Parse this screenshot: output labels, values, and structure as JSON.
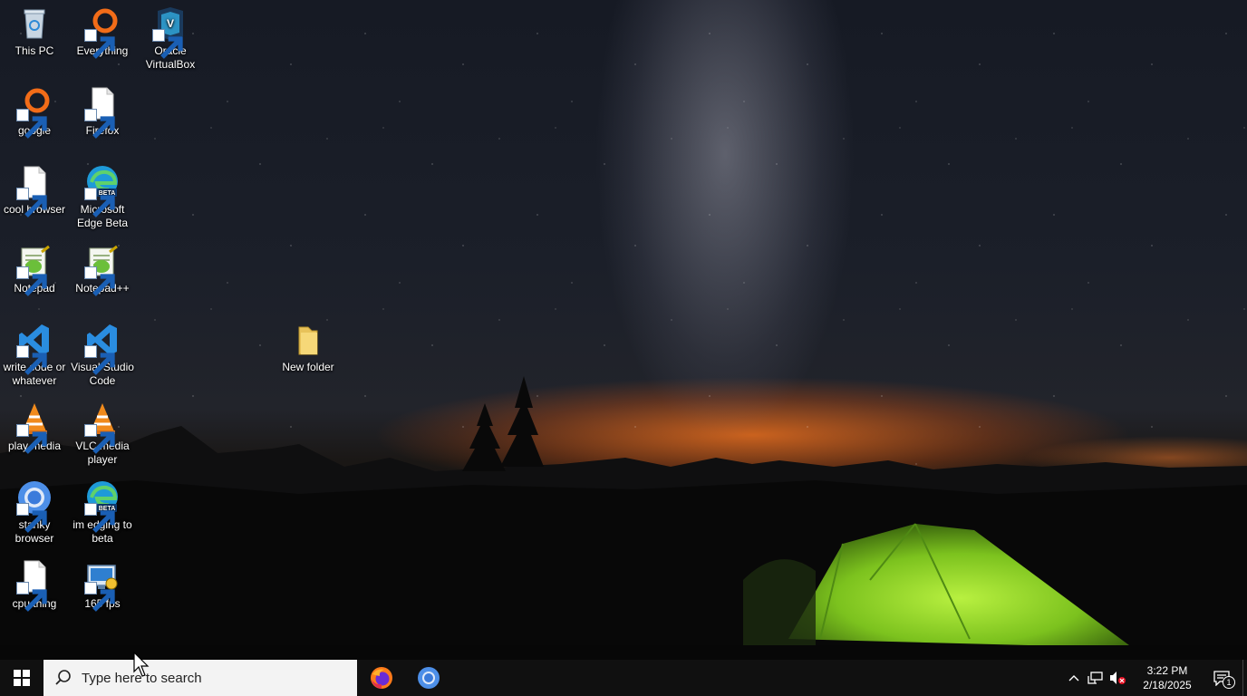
{
  "desktop": {
    "icons": [
      {
        "label": "This PC",
        "icon": "this-pc-icon"
      },
      {
        "label": "Everything",
        "icon": "everything-icon"
      },
      {
        "label": "Oracle VirtualBox",
        "icon": "virtualbox-icon"
      },
      {
        "label": "google",
        "icon": "everything-icon"
      },
      {
        "label": "Firefox",
        "icon": "blank-file-icon"
      },
      {
        "label": "cool browser",
        "icon": "blank-file-icon"
      },
      {
        "label": "Microsoft Edge Beta",
        "icon": "edge-beta-icon"
      },
      {
        "label": "Notepad",
        "icon": "notepad-icon"
      },
      {
        "label": "Notepad++",
        "icon": "notepad-icon"
      },
      {
        "label": "write code or whatever",
        "icon": "vscode-icon"
      },
      {
        "label": "Visual Studio Code",
        "icon": "vscode-icon"
      },
      {
        "label": "New folder",
        "icon": "folder-icon"
      },
      {
        "label": "play media",
        "icon": "vlc-icon"
      },
      {
        "label": "VLC media player",
        "icon": "vlc-icon"
      },
      {
        "label": "stanky browser",
        "icon": "chrome-icon"
      },
      {
        "label": "im edging to beta",
        "icon": "edge-beta-icon"
      },
      {
        "label": "cpu thing",
        "icon": "blank-file-icon"
      },
      {
        "label": "165 fps",
        "icon": "display-settings-icon"
      }
    ]
  },
  "taskbar": {
    "search_placeholder": "Type here to search",
    "pinned": [
      {
        "name": "Firefox",
        "icon": "firefox-icon"
      },
      {
        "name": "Chrome",
        "icon": "chrome-icon"
      }
    ],
    "clock": {
      "time": "3:22 PM",
      "date": "2/18/2025"
    },
    "notification_count": "1"
  },
  "colors": {
    "taskbar_bg": "#101010",
    "search_bg": "#f3f3f3",
    "accent_orange": "#f26c18",
    "tent_green": "#8fd42a"
  }
}
